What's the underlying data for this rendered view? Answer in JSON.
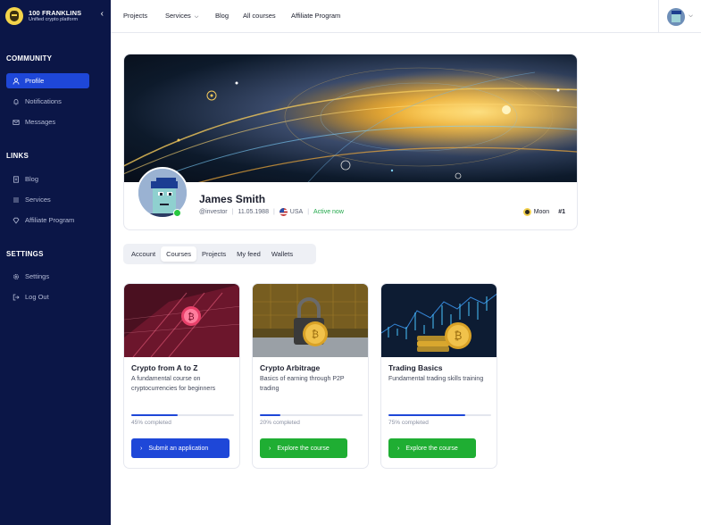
{
  "brand": {
    "name": "100 FRANKLINS",
    "tagline": "Unified crypto platform",
    "logo_icon": "franklin-logo-icon",
    "collapse_icon": "chevron-left-icon"
  },
  "sidebar": {
    "community": {
      "title": "COMMUNITY",
      "items": [
        {
          "label": "Profile",
          "icon": "user-icon",
          "active": true
        },
        {
          "label": "Notifications",
          "icon": "bell-icon"
        },
        {
          "label": "Messages",
          "icon": "mail-icon"
        }
      ]
    },
    "links": {
      "title": "LINKS",
      "items": [
        {
          "label": "Blog",
          "icon": "document-icon"
        },
        {
          "label": "Services",
          "icon": "list-icon"
        },
        {
          "label": "Affiliate Program",
          "icon": "diamond-icon"
        }
      ]
    },
    "settings": {
      "title": "SETTINGS",
      "items": [
        {
          "label": "Settings",
          "icon": "gear-icon"
        },
        {
          "label": "Log Out",
          "icon": "logout-icon"
        }
      ]
    }
  },
  "topnav": {
    "links": [
      "Projects",
      "Services",
      "Blog",
      "All courses",
      "Affiliate Program"
    ],
    "services_dropdown_icon": "chevron-down-icon"
  },
  "profile": {
    "name": "James Smith",
    "handle": "@investor",
    "birthdate": "11.05.1988",
    "country": "USA",
    "status": "Active now",
    "level": "Moon",
    "rank": "#1"
  },
  "tabs": [
    {
      "label": "Account"
    },
    {
      "label": "Courses",
      "active": true
    },
    {
      "label": "Projects"
    },
    {
      "label": "My feed"
    },
    {
      "label": "Wallets"
    }
  ],
  "courses": [
    {
      "title": "Crypto from A to Z",
      "description": "A fundamental course on cryptocurrencies for beginners",
      "progress": 45,
      "progress_text": "45% completed",
      "button": "Submit an application",
      "button_color": "#1e47d8"
    },
    {
      "title": "Crypto Arbitrage",
      "description": "Basics of earning through P2P trading",
      "progress": 20,
      "progress_text": "20% completed",
      "button": "Explore the course",
      "button_color": "#1fae33"
    },
    {
      "title": "Trading Basics",
      "description": "Fundamental trading skills training",
      "progress": 75,
      "progress_text": "75% completed",
      "button": "Explore the course",
      "button_color": "#1fae33"
    }
  ],
  "colors": {
    "sidebar_bg": "#0b1647",
    "accent": "#1e47d8",
    "success": "#1fae33",
    "online": "#28c840"
  }
}
